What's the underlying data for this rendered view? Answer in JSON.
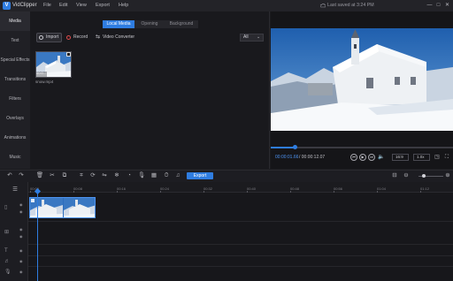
{
  "app": {
    "name": "VidClipper",
    "logo_letter": "V"
  },
  "menu": [
    "File",
    "Edit",
    "View",
    "Export",
    "Help"
  ],
  "status": {
    "last_saved": "Last saved at 3:24 PM"
  },
  "window_controls": [
    "—",
    "□",
    "✕"
  ],
  "left_nav": [
    "Media",
    "Text",
    "Special Effects",
    "Transitions",
    "Filters",
    "Overlays",
    "Animations",
    "Music"
  ],
  "media": {
    "tabs": [
      "Local Media",
      "Opening",
      "Background"
    ],
    "import_label": "Import",
    "record_label": "Record",
    "converter_label": "Video Converter",
    "filter_value": "All",
    "thumb_name": "snow.mp4",
    "thumb_duration": "00:0..."
  },
  "preview": {
    "current_time": "00:00:01.66",
    "total_time": "/ 00:00:12.07",
    "progress": 0.13,
    "aspect": "16:9",
    "speed": "1.0x"
  },
  "toolbar": {
    "export_label": "Export",
    "zoom": 0.15
  },
  "timeline": {
    "ticks": [
      "00:00",
      "00:08",
      "00:16",
      "00:24",
      "00:32",
      "00:40",
      "00:48",
      "00:56",
      "01:04",
      "01:12"
    ]
  },
  "colors": {
    "accent": "#2f7de1",
    "background": "#1b1b1f",
    "panel": "#202025"
  }
}
